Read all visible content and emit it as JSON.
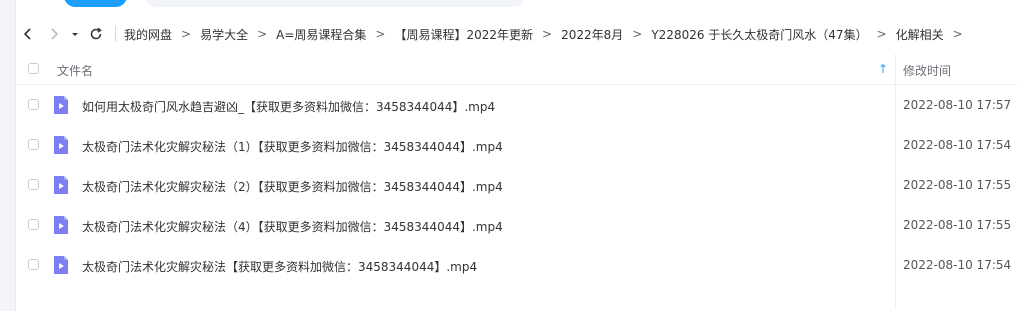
{
  "nav": {
    "icons": [
      "back-icon",
      "forward-icon",
      "dropdown-icon",
      "refresh-icon"
    ],
    "breadcrumb": [
      "我的网盘",
      "易学大全",
      "A=周易课程合集",
      "【周易课程】2022年更新",
      "2022年8月",
      "Y228026 于长久太极奇门风水（47集）",
      "化解相关"
    ],
    "separator": ">"
  },
  "header": {
    "name_label": "文件名",
    "time_label": "修改时间"
  },
  "files": [
    {
      "name": "如何用太极奇门风水趋吉避凶_【获取更多资料加微信：3458344044】.mp4",
      "modified": "2022-08-10 17:57"
    },
    {
      "name": "太极奇门法术化灾解灾秘法（1）【获取更多资料加微信：3458344044】.mp4",
      "modified": "2022-08-10 17:54"
    },
    {
      "name": "太极奇门法术化灾解灾秘法（2）【获取更多资料加微信：3458344044】.mp4",
      "modified": "2022-08-10 17:55"
    },
    {
      "name": "太极奇门法术化灾解灾秘法（4）【获取更多资料加微信：3458344044】.mp4",
      "modified": "2022-08-10 17:55"
    },
    {
      "name": "太极奇门法术化灾解灾秘法【获取更多资料加微信：3458344044】.mp4",
      "modified": "2022-08-10 17:54"
    }
  ],
  "colors": {
    "accent": "#1e9fff",
    "video_icon": "#7b7ff2"
  }
}
